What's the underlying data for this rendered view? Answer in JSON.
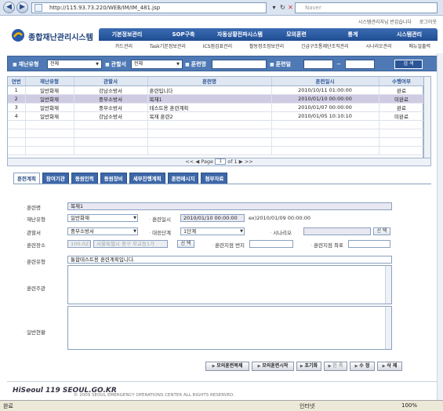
{
  "browser": {
    "back": "◀",
    "forward": "▶",
    "url": "http://115.93.73.220/WEB/IM/IM_481.jsp",
    "search_placeholder": "Naver"
  },
  "header": {
    "app_title": "종합재난관리시스템",
    "top_links": [
      "시스템관리자님 반갑습니다",
      "로그아웃"
    ],
    "main_menu": [
      "기본정보관리",
      "SOP구축",
      "자동상황전파시스템",
      "모의훈련",
      "통계",
      "시스템관리"
    ],
    "sub_menu": [
      "카드관리",
      "Task기본정보관리",
      "ICS점검표관리",
      "활동정조정보관리",
      "긴급구조통제단조직관리",
      "시나리오관리",
      "매뉴얼출력"
    ]
  },
  "search": {
    "disaster_type_label": "재난유형",
    "disaster_type_value": "전체",
    "jurisdiction_label": "관할서",
    "jurisdiction_value": "전체",
    "training_name_label": "훈련명",
    "training_name_value": "",
    "training_date_label": "훈련일",
    "date_from": "",
    "date_sep": "~",
    "date_to": "",
    "search_button": "검 색"
  },
  "grid": {
    "columns": [
      "연번",
      "재난유형",
      "관할서",
      "훈련명",
      "훈련일시",
      "수행여부"
    ],
    "rows": [
      [
        "1",
        "일반화재",
        "강남소방서",
        "훈련입니다",
        "2010/10/11 01:00:00",
        "완료"
      ],
      [
        "2",
        "일반화재",
        "중부소방서",
        "복재1",
        "2010/01/10 00:00:00",
        "미완료"
      ],
      [
        "3",
        "일반화재",
        "중부소방서",
        "테스트용 훈련계획",
        "2010/01/07 00:00:00",
        "완료"
      ],
      [
        "4",
        "일반화재",
        "강남소방서",
        "복재 훈련2",
        "2010/01/05 10:10:10",
        "미완료"
      ]
    ],
    "selected_row": 1,
    "pager_prev": "<< ◀",
    "pager_page_label": "Page",
    "pager_page": "1",
    "pager_of": "of 1",
    "pager_next": "▶ >>"
  },
  "tabs": [
    "훈련계획",
    "참여기관",
    "동원인력",
    "동원장비",
    "세부진행계획",
    "훈련메시지",
    "첨부자료"
  ],
  "form": {
    "training_name_label": "훈련명",
    "training_name_value": "복재1",
    "disaster_type_label": "재난유형",
    "disaster_type_value": "일반화재",
    "training_datetime_label": "훈련일시",
    "training_datetime_value": "2010/01/10 00:00:00",
    "training_datetime_example": "ex)2010/01/09 00:00:00",
    "jurisdiction_label": "관할서",
    "jurisdiction_value": "중부소방서",
    "response_level_label": "대응단계",
    "response_level_value": "1단계",
    "scenario_label": "시나리오",
    "scenario_value": "",
    "scenario_select_button": "선 택",
    "place_label": "훈련장소",
    "place_zip": "100-021",
    "place_address": "서울특별시 중구 무교동1가",
    "place_select_button": "선 택",
    "place_detail_label": "훈련지점 번지",
    "place_detail_value": "",
    "place_coord_label": "훈련지점 좌표",
    "place_coord_value": "",
    "training_type_label": "훈련유형",
    "training_type_value": "통합테스트용 훈련계획입니다.",
    "training_subject_label": "훈련주관",
    "training_subject_value": "",
    "notes_label": "일반현황",
    "notes_value": ""
  },
  "actions": [
    "모의훈련복제",
    "모의훈련시작",
    "초기화",
    "한 록",
    "수 정",
    "삭 제"
  ],
  "actions_disabled": [
    3
  ],
  "footer": {
    "logo": "HiSeoul 119 SEOUL.GO.KR",
    "copyright": "© 2009 SEOUL EMERGENCY OPERATIONS CENTER ALL RIGHTS RESERVED."
  },
  "status": {
    "left": "완료",
    "zone": "인터넷",
    "zoom": "100%"
  }
}
